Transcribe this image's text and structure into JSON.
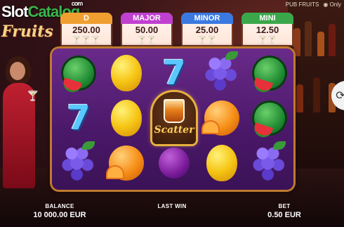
{
  "watermark": {
    "brand_slot": "Slot",
    "brand_catalog": "Catalog",
    "brand_com": "com"
  },
  "game_logo": "Fruits",
  "top_right": {
    "title": "PUB FRUITS",
    "only_label": "Only"
  },
  "jackpots": [
    {
      "name": "D",
      "value": "250.00",
      "color": "#f0a030"
    },
    {
      "name": "MAJOR",
      "value": "50.00",
      "color": "#c040d0"
    },
    {
      "name": "MINOR",
      "value": "25.00",
      "color": "#3a7ae0"
    },
    {
      "name": "MINI",
      "value": "12.50",
      "color": "#3aa84a"
    }
  ],
  "reels": [
    [
      "watermelon",
      "seven",
      "grapes"
    ],
    [
      "lemon",
      "lemon",
      "orange"
    ],
    [
      "seven",
      "scatter",
      "plum"
    ],
    [
      "grapes",
      "orange",
      "lemon"
    ],
    [
      "watermelon",
      "watermelon",
      "grapes"
    ]
  ],
  "scatter_label": "Scatter",
  "footer": {
    "balance_label": "BALANCE",
    "balance_value": "10 000.00 EUR",
    "last_win_label": "LAST WIN",
    "last_win_value": "",
    "bet_label": "BET",
    "bet_value": "0.50 EUR"
  }
}
